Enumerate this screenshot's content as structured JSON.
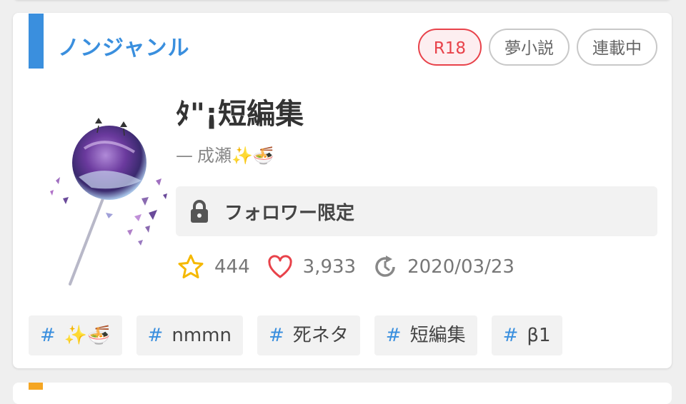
{
  "card": {
    "genre": "ノンジャンル",
    "badges": [
      {
        "label": "R18"
      },
      {
        "label": "夢小説"
      },
      {
        "label": "連載中"
      }
    ],
    "title": "ﾀ\"¡短編集",
    "author_prefix": "—",
    "author": "成瀬✨🍜",
    "lock_label": "フォロワー限定",
    "stats": {
      "stars": "444",
      "likes": "3,933",
      "updated": "2020/03/23"
    },
    "tags": [
      {
        "hash": "#",
        "label": "✨🍜"
      },
      {
        "hash": "#",
        "label": "nmmn"
      },
      {
        "hash": "#",
        "label": "死ネタ"
      },
      {
        "hash": "#",
        "label": "短編集"
      },
      {
        "hash": "#",
        "label": "β1"
      }
    ]
  },
  "colors": {
    "accent": "#3a8fde",
    "r18": "#e8424a",
    "star": "#f5b800",
    "heart": "#e8424a"
  }
}
